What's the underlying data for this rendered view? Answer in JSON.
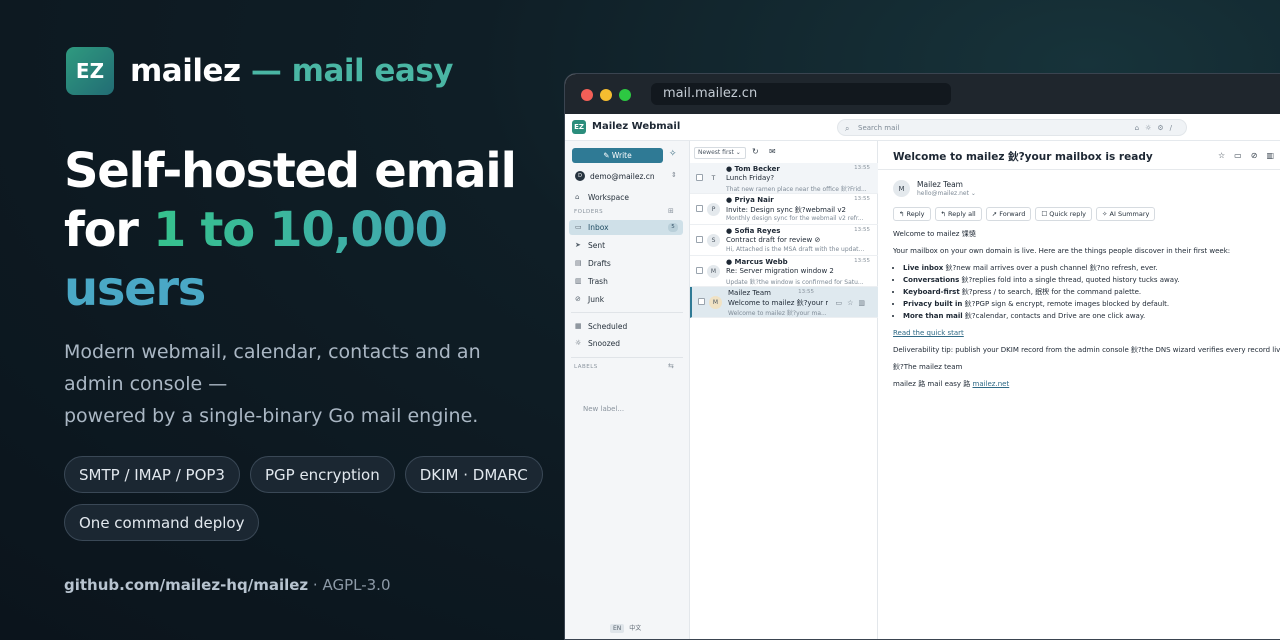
{
  "hero": {
    "logo_text": "EZ",
    "brand_name": "mailez",
    "brand_tagline": "— mail easy",
    "title_line1": "Self-hosted email",
    "title_for": "for ",
    "title_range": "1 to 10,000",
    "title_users": "users",
    "subtitle_line1": "Modern webmail, calendar, contacts and an admin console —",
    "subtitle_line2": "powered by a single-binary Go mail engine.",
    "chips": [
      "SMTP / IMAP / POP3",
      "PGP encryption",
      "DKIM · DMARC",
      "One command deploy"
    ],
    "repo": "github.com/mailez-hq/mailez",
    "license": " · AGPL-3.0"
  },
  "browser": {
    "url": "mail.mailez.cn"
  },
  "app": {
    "logo_text": "EZ",
    "name": "Mailez Webmail",
    "search_placeholder": "Search mail",
    "search_tools": "⌂☼⚙/",
    "write_label": "✎ Write",
    "account": "demo@mailez.cn",
    "account_initial": "D",
    "nav": {
      "workspace": "Workspace",
      "folders_head": "FOLDERS",
      "inbox": "Inbox",
      "inbox_count": "5",
      "sent": "Sent",
      "drafts": "Drafts",
      "trash": "Trash",
      "junk": "Junk",
      "scheduled": "Scheduled",
      "snoozed": "Snoozed",
      "labels_head": "LABELS",
      "new_label": "New label..."
    },
    "lang_en": "EN",
    "lang_zh": "中文",
    "sort_label": "Newest first ⌄",
    "messages": [
      {
        "initial": "T",
        "from": "● Tom Becker",
        "time": "13:55",
        "subject": "Lunch Friday?",
        "preview": "That new ramen place near the office 鈥?Frid..."
      },
      {
        "initial": "P",
        "from": "● Priya Nair",
        "time": "13:55",
        "subject": "Invite: Design sync 鈥?webmail v2",
        "preview": "Monthly design sync for the webmail v2 refr..."
      },
      {
        "initial": "S",
        "from": "● Sofia Reyes",
        "time": "13:55",
        "subject": "Contract draft for review ⊘",
        "preview": "Hi, Attached is the MSA draft with the updat..."
      },
      {
        "initial": "M",
        "from": "● Marcus Webb",
        "time": "13:55",
        "subject": "Re: Server migration window  2",
        "preview": "Update 鈥?the window is confirmed for Satu..."
      },
      {
        "initial": "M",
        "from": "Mailez Team",
        "time": "13:55",
        "subject": "Welcome to mailez 鈥?your ma...",
        "preview": "Welcome to mailez 鈥?your ma..."
      }
    ],
    "reading": {
      "title": "Welcome to mailez 鈥?your mailbox is ready",
      "sender_initial": "M",
      "sender": "Mailez Team",
      "sender_addr": "hello@mailez.net ⌄",
      "buttons": [
        "↰ Reply",
        "↰ Reply all",
        "➚ Forward",
        "☐ Quick reply",
        "✧ AI Summary"
      ],
      "greeting": "Welcome to mailez 馃憢",
      "intro": "Your mailbox on your own domain is live. Here are the things people discover in their first week:",
      "bullets": [
        {
          "b": "Live inbox",
          "t": " 鈥?new mail arrives over a push channel 鈥?no refresh, ever."
        },
        {
          "b": "Conversations",
          "t": " 鈥?replies fold into a single thread, quoted history tucks away."
        },
        {
          "b": "Keyboard-first",
          "t": " 鈥?press / to search, 鈱楰 for the command palette."
        },
        {
          "b": "Privacy built in",
          "t": " 鈥?PGP sign & encrypt, remote images blocked by default."
        },
        {
          "b": "More than mail",
          "t": " 鈥?calendar, contacts and Drive are one click away."
        }
      ],
      "link": "Read the quick start",
      "tip": "Deliverability tip: publish your DKIM record from the admin console 鈥?the DNS wizard verifies every record live.",
      "signoff": "鈥?The mailez team",
      "footer_text": "mailez 路 mail easy 路 ",
      "footer_link": "mailez.net"
    }
  }
}
